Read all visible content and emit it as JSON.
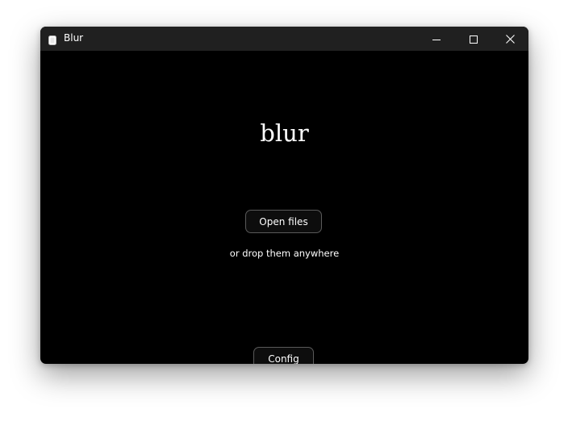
{
  "window": {
    "title": "Blur",
    "controls": {
      "minimize": "minimize-icon",
      "maximize": "maximize-icon",
      "close": "close-icon"
    }
  },
  "main": {
    "app_title": "blur",
    "open_button_label": "Open files",
    "drop_hint": "or drop them anywhere",
    "config_button_label": "Config"
  },
  "colors": {
    "background": "#000000",
    "titlebar": "#202020",
    "text": "#ffffff",
    "button_border": "#5a5a5a"
  }
}
